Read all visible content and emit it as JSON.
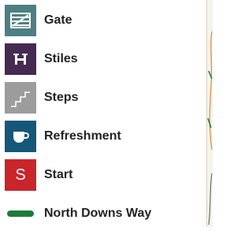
{
  "legend": {
    "items": [
      {
        "label": "Gate",
        "icon": "gate-icon",
        "color": "#4e7f82"
      },
      {
        "label": "Stiles",
        "icon": "stile-icon",
        "color": "#452a52"
      },
      {
        "label": "Steps",
        "icon": "steps-icon",
        "color": "#9c9c9c"
      },
      {
        "label": "Refreshment",
        "icon": "cup-icon",
        "color": "#15577a"
      },
      {
        "label": "Start",
        "icon": "start-icon",
        "color": "#c9252b",
        "symbol": "S"
      },
      {
        "label": "North Downs Way",
        "icon": "route-line-icon",
        "color": "#1f7a3a"
      }
    ]
  },
  "map_strip": {
    "color": "#f6f3ea",
    "route_color": "#e08a3c",
    "path_color": "#1f7a3a"
  }
}
